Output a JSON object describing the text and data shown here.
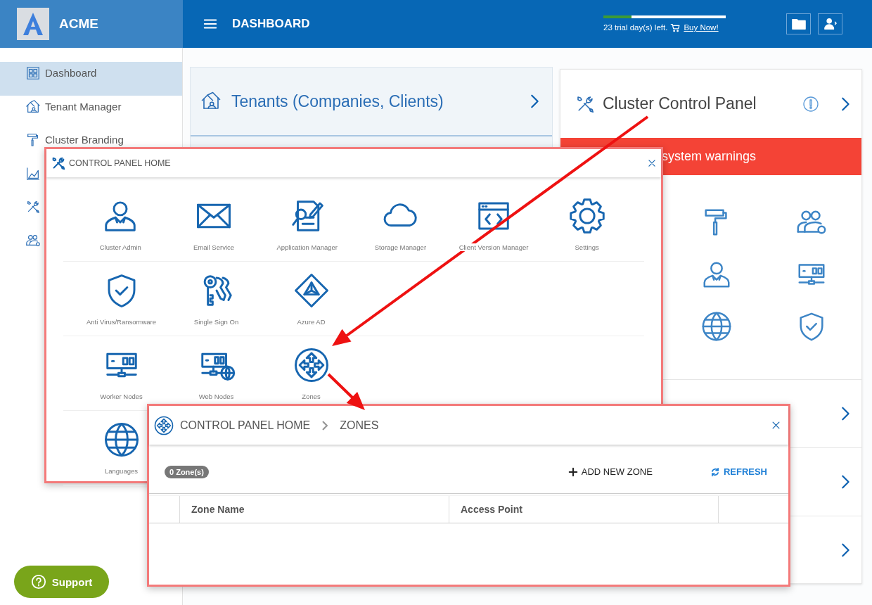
{
  "header": {
    "brand": "ACME",
    "title": "DASHBOARD",
    "trial": {
      "text": "23 trial day(s) left.",
      "level": 0.23,
      "link": "Buy Now!"
    }
  },
  "sidebar": {
    "items": [
      {
        "label": "Dashboard",
        "selected": true
      },
      {
        "label": "Tenant Manager",
        "selected": false
      },
      {
        "label": "Cluster Branding",
        "selected": false
      },
      {
        "selected": false
      },
      {
        "selected": false
      },
      {
        "selected": false
      }
    ]
  },
  "tenants_card": {
    "title": "Tenants (Companies, Clients)"
  },
  "cluster_card": {
    "title": "Cluster Control Panel",
    "alert": "system warnings"
  },
  "control_panel_dialog": {
    "title": "CONTROL PANEL HOME",
    "rows": [
      [
        {
          "label": "Cluster Admin"
        },
        {
          "label": "Email Service"
        },
        {
          "label": "Application Manager"
        },
        {
          "label": "Storage Manager"
        },
        {
          "label": "Client Version Manager"
        },
        {
          "label": "Settings"
        }
      ],
      [
        {
          "label": "Anti Virus/Ransomware"
        },
        {
          "label": "Single Sign On"
        },
        {
          "label": "Azure AD"
        }
      ],
      [
        {
          "label": "Worker Nodes"
        },
        {
          "label": "Web Nodes"
        },
        {
          "label": "Zones"
        }
      ],
      [
        {
          "label": "Languages"
        }
      ]
    ]
  },
  "zones_dialog": {
    "breadcrumb": [
      "CONTROL PANEL HOME",
      "ZONES"
    ],
    "count": "0 Zone(s)",
    "actions": [
      {
        "kind": "add",
        "label": "ADD NEW ZONE"
      },
      {
        "kind": "refresh",
        "label": "REFRESH"
      }
    ],
    "columns": [
      "Zone Name",
      "Access Point"
    ]
  },
  "support": {
    "label": "Support"
  }
}
